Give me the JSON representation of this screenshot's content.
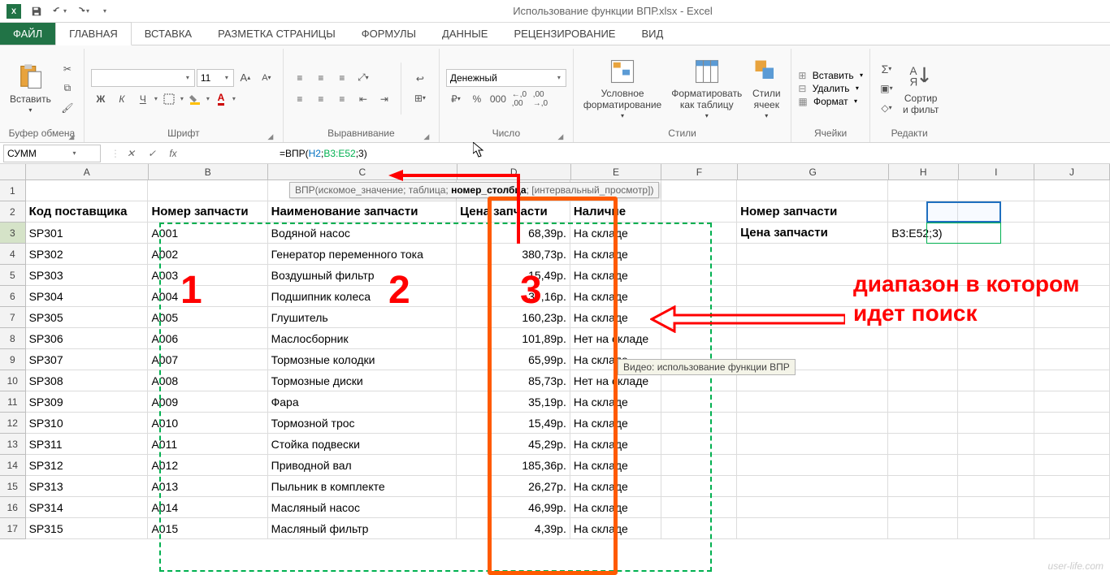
{
  "title": "Использование функции ВПР.xlsx - Excel",
  "tabs": {
    "file": "ФАЙЛ",
    "home": "ГЛАВНАЯ",
    "insert": "ВСТАВКА",
    "layout": "РАЗМЕТКА СТРАНИЦЫ",
    "formulas": "ФОРМУЛЫ",
    "data": "ДАННЫЕ",
    "review": "РЕЦЕНЗИРОВАНИЕ",
    "view": "ВИД"
  },
  "ribbon": {
    "clipboard": {
      "paste": "Вставить",
      "label": "Буфер обмена"
    },
    "font": {
      "size": "11",
      "label": "Шрифт",
      "b": "Ж",
      "i": "К",
      "u": "Ч"
    },
    "align": {
      "label": "Выравнивание"
    },
    "number": {
      "format": "Денежный",
      "label": "Число"
    },
    "styles": {
      "cond": "Условное\nформатирование",
      "table": "Форматировать\nкак таблицу",
      "cell": "Стили\nячеек",
      "label": "Стили"
    },
    "cells": {
      "insert": "Вставить",
      "delete": "Удалить",
      "format": "Формат",
      "label": "Ячейки"
    },
    "editing": {
      "sort": "Сортир\nи фильт",
      "label": "Редакти"
    }
  },
  "namebox": "СУММ",
  "formula": {
    "prefix": "=ВПР(",
    "ref1": "H2",
    "sep1": ";",
    "ref2": "B3:E52",
    "sep2": ";3)"
  },
  "fn_hint": {
    "name": "ВПР",
    "args": "(искомое_значение; таблица; ",
    "active": "номер_столбца",
    "rest": "; [интервальный_просмотр])"
  },
  "video_tip": "Видео: использование функции ВПР",
  "colwidths": {
    "A": 162,
    "B": 158,
    "C": 250,
    "D": 150,
    "E": 120,
    "F": 100,
    "G": 200,
    "H": 92,
    "I": 100,
    "J": 100
  },
  "colheads": [
    "A",
    "B",
    "C",
    "D",
    "E",
    "F",
    "G",
    "H",
    "I",
    "J"
  ],
  "header_row": {
    "A": "Код поставщика",
    "B": "Номер запчасти",
    "C": "Наименование запчасти",
    "D": "Цена запчасти",
    "E": "Наличие",
    "G": "Номер запчасти",
    "G3": "Цена запчасти",
    "H3": "B3:E52;3)"
  },
  "rows": [
    {
      "r": 3,
      "A": "SP301",
      "B": "A001",
      "C": "Водяной насос",
      "D": "68,39р.",
      "E": "На складе"
    },
    {
      "r": 4,
      "A": "SP302",
      "B": "A002",
      "C": "Генератор переменного тока",
      "D": "380,73р.",
      "E": "На складе"
    },
    {
      "r": 5,
      "A": "SP303",
      "B": "A003",
      "C": "Воздушный фильтр",
      "D": "15,49р.",
      "E": "На складе"
    },
    {
      "r": 6,
      "A": "SP304",
      "B": "A004",
      "C": "Подшипник колеса",
      "D": "35,16р.",
      "E": "На складе"
    },
    {
      "r": 7,
      "A": "SP305",
      "B": "A005",
      "C": "Глушитель",
      "D": "160,23р.",
      "E": "На складе"
    },
    {
      "r": 8,
      "A": "SP306",
      "B": "A006",
      "C": "Маслосборник",
      "D": "101,89р.",
      "E": "Нет на складе"
    },
    {
      "r": 9,
      "A": "SP307",
      "B": "A007",
      "C": "Тормозные колодки",
      "D": "65,99р.",
      "E": "На складе"
    },
    {
      "r": 10,
      "A": "SP308",
      "B": "A008",
      "C": "Тормозные диски",
      "D": "85,73р.",
      "E": "Нет на складе"
    },
    {
      "r": 11,
      "A": "SP309",
      "B": "A009",
      "C": "Фара",
      "D": "35,19р.",
      "E": "На складе"
    },
    {
      "r": 12,
      "A": "SP310",
      "B": "A010",
      "C": "Тормозной трос",
      "D": "15,49р.",
      "E": "На складе"
    },
    {
      "r": 13,
      "A": "SP311",
      "B": "A011",
      "C": "Стойка подвески",
      "D": "45,29р.",
      "E": "На складе"
    },
    {
      "r": 14,
      "A": "SP312",
      "B": "A012",
      "C": "Приводной вал",
      "D": "185,36р.",
      "E": "На складе"
    },
    {
      "r": 15,
      "A": "SP313",
      "B": "A013",
      "C": "Пыльник в комплекте",
      "D": "26,27р.",
      "E": "На складе"
    },
    {
      "r": 16,
      "A": "SP314",
      "B": "A014",
      "C": "Масляный насос",
      "D": "46,99р.",
      "E": "На складе"
    },
    {
      "r": 17,
      "A": "SP315",
      "B": "A015",
      "C": "Масляный фильтр",
      "D": "4,39р.",
      "E": "На складе"
    }
  ],
  "annotation": {
    "n1": "1",
    "n2": "2",
    "n3": "3",
    "text": "диапазон в котором идет поиск"
  },
  "watermark": "user-life.com"
}
